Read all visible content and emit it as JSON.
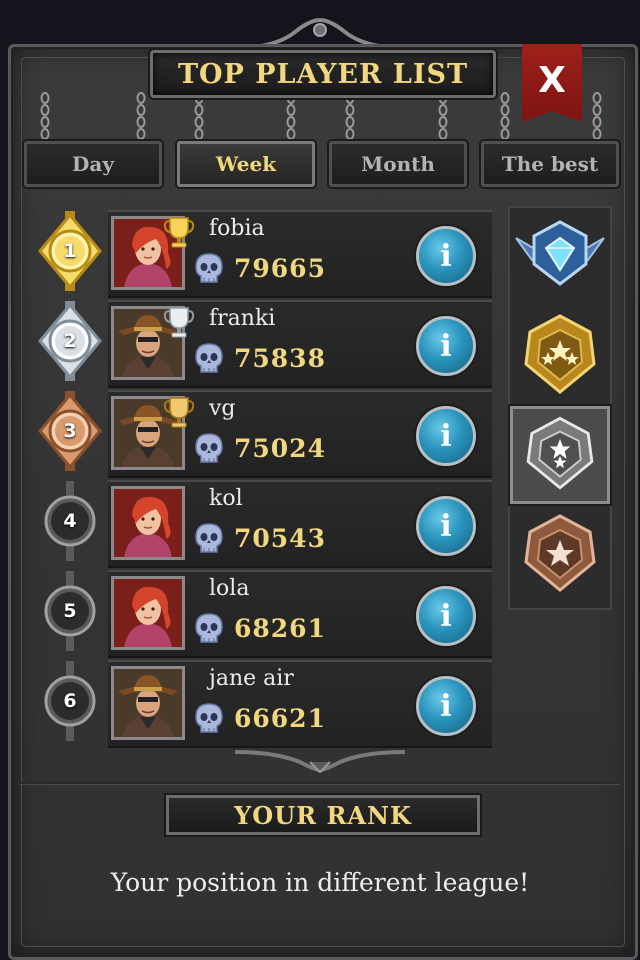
{
  "header": {
    "title": "TOP PLAYER LIST",
    "close_label": "X"
  },
  "tabs": [
    {
      "label": "Day",
      "active": false
    },
    {
      "label": "Week",
      "active": true
    },
    {
      "label": "Month",
      "active": false
    },
    {
      "label": "The best",
      "active": false
    }
  ],
  "players": [
    {
      "rank": "1",
      "name": "fobia",
      "score": "79665",
      "portrait": "female-redhead-portrait",
      "trophy": "gold-trophy-icon",
      "medal": "gold"
    },
    {
      "rank": "2",
      "name": "franki",
      "score": "75838",
      "portrait": "male-cowboy-portrait",
      "trophy": "silver-trophy-icon",
      "medal": "silver"
    },
    {
      "rank": "3",
      "name": "vg",
      "score": "75024",
      "portrait": "male-cowboy-portrait",
      "trophy": "bronze-trophy-icon",
      "medal": "bronze"
    },
    {
      "rank": "4",
      "name": "kol",
      "score": "70543",
      "portrait": "female-redhead-portrait",
      "trophy": null,
      "medal": "plain"
    },
    {
      "rank": "5",
      "name": "lola",
      "score": "68261",
      "portrait": "female-redhead-portrait",
      "trophy": null,
      "medal": "plain"
    },
    {
      "rank": "6",
      "name": "jane air",
      "score": "66621",
      "portrait": "male-cowboy-portrait",
      "trophy": null,
      "medal": "plain"
    }
  ],
  "leagues": [
    {
      "icon": "diamond-league-icon",
      "selected": false
    },
    {
      "icon": "gold-league-icon",
      "selected": false
    },
    {
      "icon": "silver-league-icon",
      "selected": true
    },
    {
      "icon": "bronze-league-icon",
      "selected": false
    }
  ],
  "your_rank": {
    "title": "YOUR RANK",
    "message": "Your position in different league!"
  },
  "colors": {
    "gold_text": "#f1d77e",
    "panel": "#353536",
    "info_blue": "#2a94bd",
    "close_red": "#a0201a"
  }
}
